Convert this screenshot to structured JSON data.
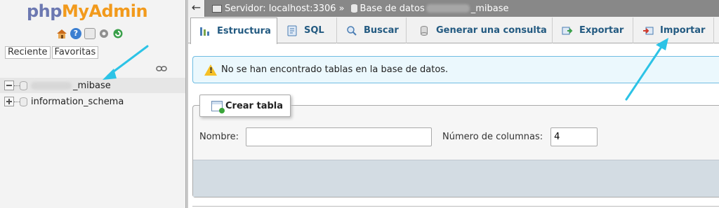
{
  "nav": {
    "logo_php": "php",
    "logo_myadmin": "MyAdmin",
    "icons": [
      "home-icon",
      "help-icon",
      "docs-icon",
      "settings-icon",
      "reload-icon"
    ],
    "tabs": [
      "Reciente",
      "Favoritas"
    ],
    "databases": [
      {
        "name_suffix": "_mibase",
        "selected": true
      },
      {
        "name": "information_schema",
        "selected": false
      }
    ]
  },
  "breadcrumb": {
    "server": "Servidor: localhost:3306",
    "sep": "»",
    "database_label": "Base de datos",
    "database_suffix": "_mibase"
  },
  "tabs": [
    {
      "label": "Estructura",
      "icon": "structure-icon",
      "active": true
    },
    {
      "label": "SQL",
      "icon": "sql-icon"
    },
    {
      "label": "Buscar",
      "icon": "search-icon"
    },
    {
      "label": "Generar una consulta",
      "icon": "query-icon"
    },
    {
      "label": "Exportar",
      "icon": "export-icon"
    },
    {
      "label": "Importar",
      "icon": "import-icon"
    }
  ],
  "notice": {
    "text": "No se han encontrado tablas en la base de datos."
  },
  "create_table": {
    "legend": "Crear tabla",
    "name_label": "Nombre:",
    "name_value": "",
    "columns_label": "Número de columnas:",
    "columns_value": "4"
  },
  "colors": {
    "accent": "#235a81",
    "notice_bg": "#ebf8fd",
    "arrow": "#2cc3e6"
  }
}
